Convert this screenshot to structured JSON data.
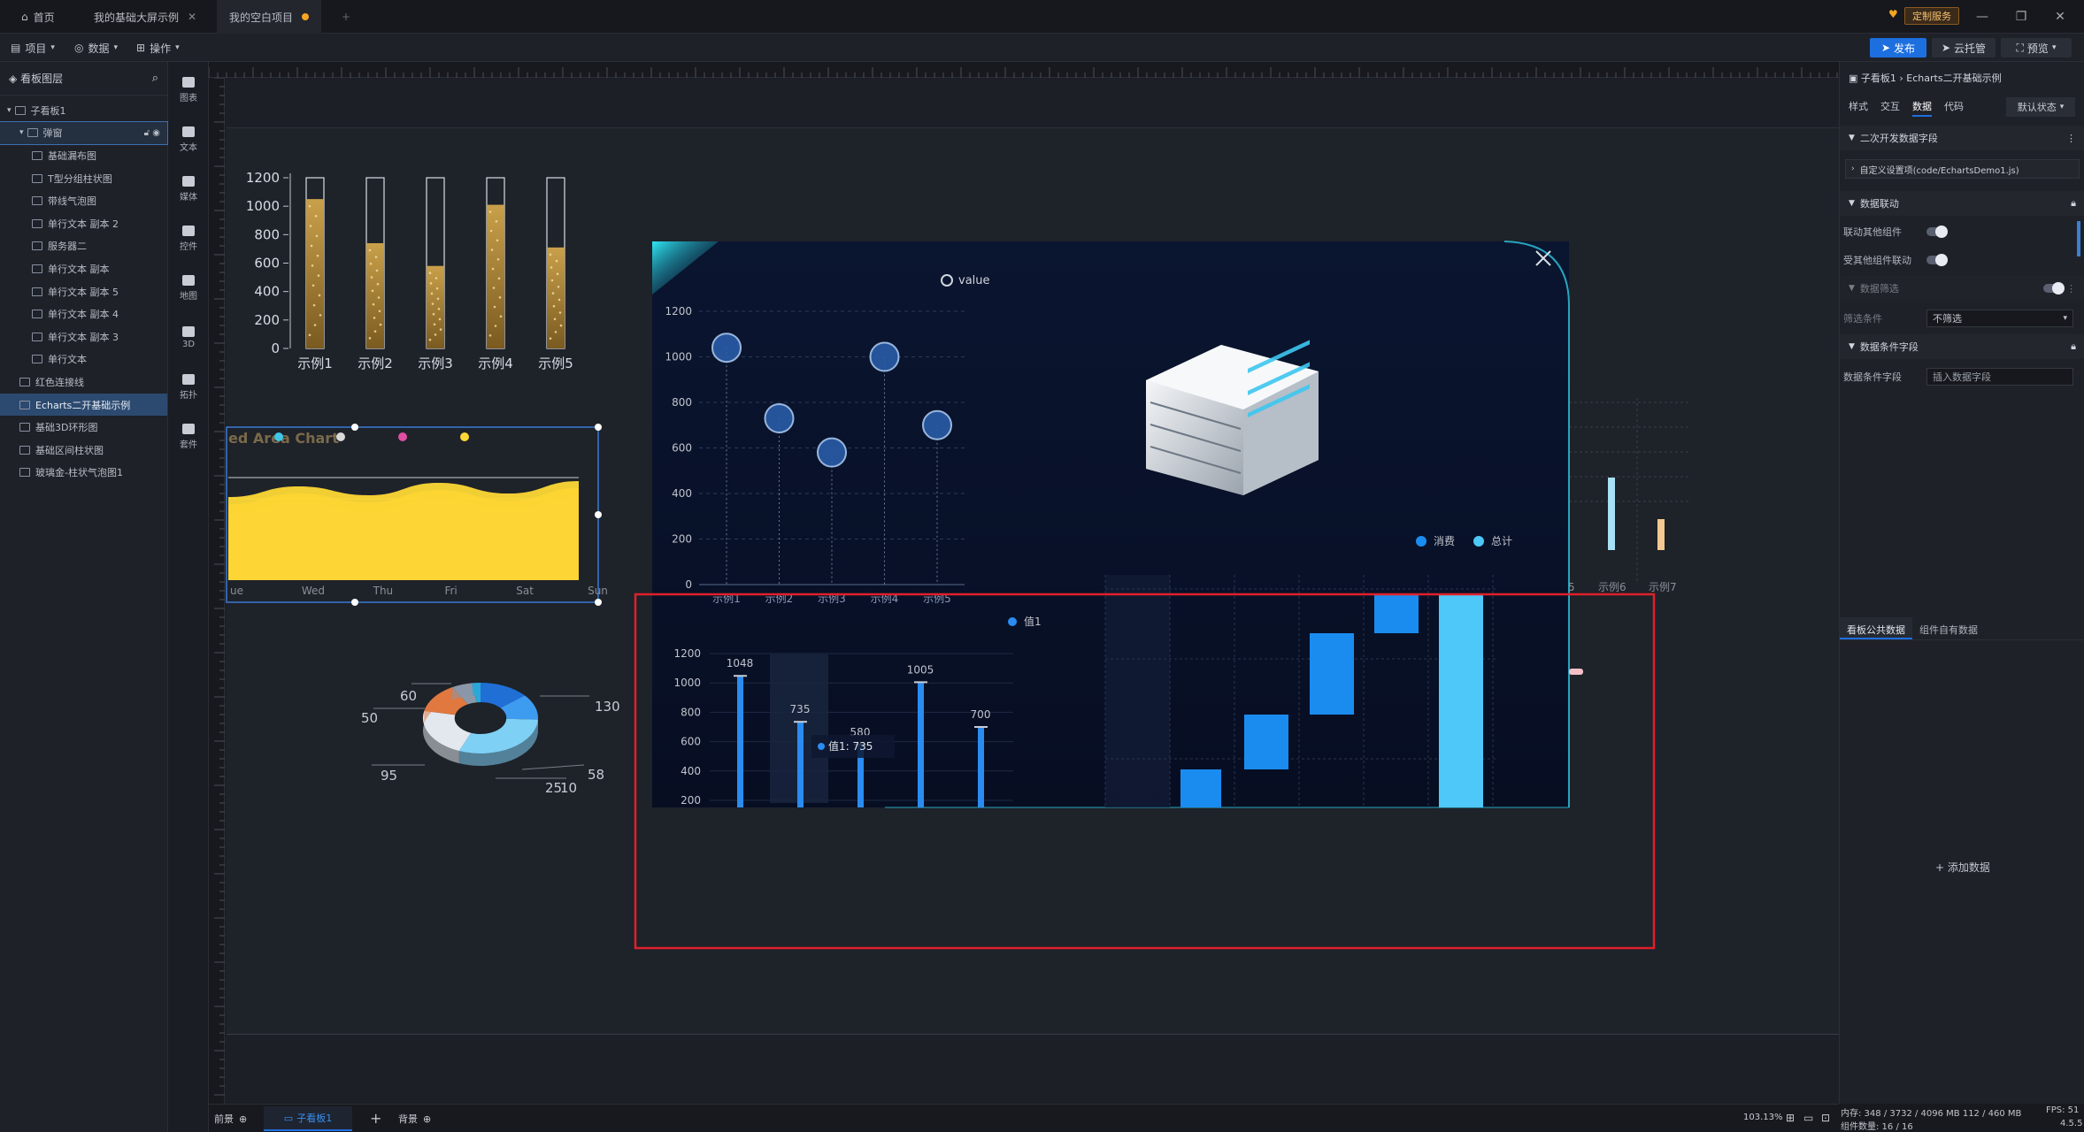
{
  "tabs": [
    {
      "label": "首页",
      "icon": "home-icon"
    },
    {
      "label": "我的基础大屏示例",
      "closable": true
    },
    {
      "label": "我的空白项目",
      "unsaved": true
    }
  ],
  "titlebar": {
    "vip_label": "定制服务"
  },
  "toolbar": {
    "menu_project": "项目",
    "menu_data": "数据",
    "menu_operate": "操作",
    "publish": "发布",
    "cloud_host": "云托管",
    "preview": "预览"
  },
  "layers": {
    "header": "看板图层",
    "items": [
      {
        "label": "子看板1",
        "indent": 0,
        "type": "group"
      },
      {
        "label": "弹窗",
        "indent": 1,
        "type": "group",
        "selected": true
      },
      {
        "label": "基础漏布图",
        "indent": 2
      },
      {
        "label": "T型分组柱状图",
        "indent": 2
      },
      {
        "label": "带线气泡图",
        "indent": 2
      },
      {
        "label": "单行文本 副本 2",
        "indent": 2
      },
      {
        "label": "服务器二",
        "indent": 2
      },
      {
        "label": "单行文本 副本",
        "indent": 2
      },
      {
        "label": "单行文本 副本 5",
        "indent": 2
      },
      {
        "label": "单行文本 副本 4",
        "indent": 2
      },
      {
        "label": "单行文本 副本 3",
        "indent": 2
      },
      {
        "label": "单行文本",
        "indent": 2
      },
      {
        "label": "红色连接线",
        "indent": 1
      },
      {
        "label": "Echarts二开基础示例",
        "indent": 1,
        "active": true
      },
      {
        "label": "基础3D环形图",
        "indent": 1
      },
      {
        "label": "基础区间柱状图",
        "indent": 1
      },
      {
        "label": "玻璃金-柱状气泡图1",
        "indent": 1
      }
    ]
  },
  "rail": [
    "图表",
    "文本",
    "媒体",
    "控件",
    "地图",
    "3D",
    "拓扑",
    "套件"
  ],
  "right_panel": {
    "breadcrumb": "子看板1 › Echarts二开基础示例",
    "tabs": [
      "样式",
      "交互",
      "数据",
      "代码"
    ],
    "active_tab": "数据",
    "state": "默认状态",
    "sec_dev": "二次开发数据字段",
    "custom_config": "自定义设置项(code/EchartsDemo1.js)",
    "linkage": "数据联动",
    "link_other": "联动其他组件",
    "linked_by": "受其他组件联动",
    "filter_title": "数据筛选",
    "filter_label": "筛选条件",
    "filter_value": "不筛选",
    "cond_title": "数据条件字段",
    "cond_label": "数据条件字段",
    "cond_placeholder": "插入数据字段",
    "data_tabs": [
      "看板公共数据",
      "组件自有数据"
    ],
    "add_data": "添加数据"
  },
  "bottom": {
    "front": "前景",
    "sub_board": "子看板1",
    "background": "背景",
    "zoom": "103.13%",
    "memory": "内存: 348 / 3732 / 4096 MB 112 / 460 MB",
    "fps": "FPS: 51",
    "components": "组件数量: 16 / 16",
    "version": "4.5.5"
  },
  "chart_data": [
    {
      "type": "bar",
      "name": "Top-left stacked cylinders",
      "categories": [
        "示例1",
        "示例2",
        "示例3",
        "示例4",
        "示例5"
      ],
      "values": [
        1050,
        740,
        580,
        1010,
        710
      ],
      "max": 1200,
      "yticks": [
        0,
        200,
        400,
        600,
        800,
        1000,
        1200
      ]
    },
    {
      "type": "area",
      "title": "ed Area Chart",
      "categories": [
        "ue",
        "Wed",
        "Thu",
        "Fri",
        "Sat",
        "Sun"
      ],
      "colors": [
        "#3ec7e8",
        "#7b5cf0",
        "#e04ea0",
        "#f5a623",
        "#fdd835"
      ]
    },
    {
      "type": "pie",
      "labels_visible": [
        "60",
        "50",
        "130",
        "95",
        "58",
        "25",
        "10"
      ],
      "values": [
        60,
        50,
        130,
        95,
        58,
        25,
        10
      ]
    },
    {
      "type": "scatter",
      "legend": "value",
      "categories": [
        "示例1",
        "示例2",
        "示例3",
        "示例4",
        "示例5"
      ],
      "values": [
        1040,
        730,
        580,
        1000,
        700
      ],
      "yticks": [
        0,
        200,
        400,
        600,
        800,
        1000,
        1200
      ]
    },
    {
      "type": "bar",
      "legend": "值1",
      "tooltip": "值1: 735",
      "values": [
        1048,
        735,
        580,
        1005,
        700
      ],
      "yticks": [
        200,
        400,
        600,
        800,
        1000,
        1200
      ]
    },
    {
      "type": "bar",
      "legend": [
        "消费",
        "总计"
      ],
      "partial_categories": [
        "示例6",
        "示例7"
      ]
    }
  ]
}
